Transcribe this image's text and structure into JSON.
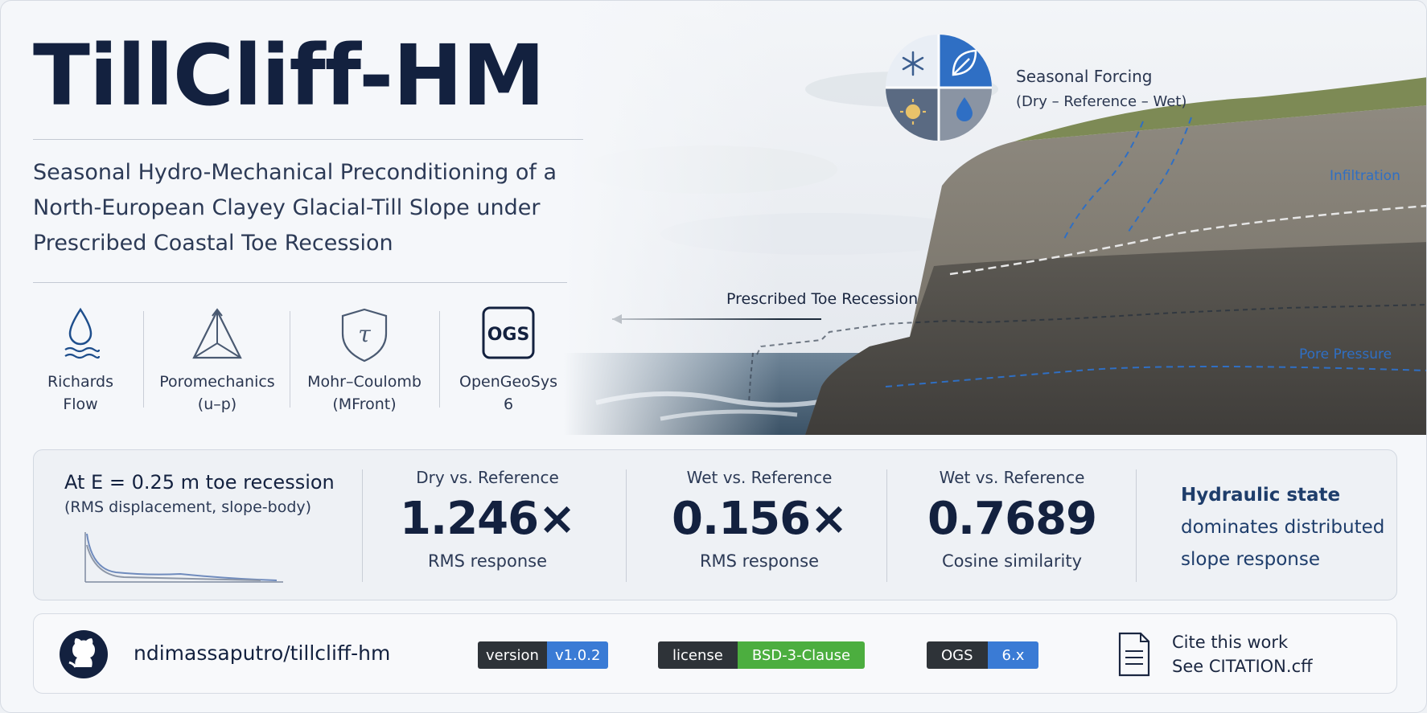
{
  "title": "TillCliff-HM",
  "subtitle": "Seasonal Hydro-Mechanical Preconditioning of a North-European Clayey Glacial-Till Slope under Prescribed Coastal Toe Recession",
  "features": [
    {
      "line1": "Richards",
      "line2": "Flow",
      "icon": "water-drop-icon"
    },
    {
      "line1": "Poromechanics",
      "line2": "(u–p)",
      "icon": "triangle-truss-icon"
    },
    {
      "line1": "Mohr–Coulomb",
      "line2": "(MFront)",
      "icon": "tau-shield-icon"
    },
    {
      "line1": "OpenGeoSys",
      "line2": "6",
      "icon": "ogs-logo-icon",
      "icon_text": "OGS"
    }
  ],
  "seasonal": {
    "title": "Seasonal Forcing",
    "subtitle": "(Dry – Reference – Wet)",
    "quadrants": [
      "snowflake-icon",
      "leaf-icon",
      "sun-icon",
      "water-drop-icon"
    ]
  },
  "annotations": {
    "toe": "Prescribed Toe Recession",
    "infiltration": "Infiltration",
    "pore": "Pore Pressure"
  },
  "stats": {
    "heading": "At E = 0.25 m toe recession",
    "subheading": "(RMS displacement, slope-body)",
    "metrics": [
      {
        "top": "Dry vs. Reference",
        "value": "1.246×",
        "bottom": "RMS response"
      },
      {
        "top": "Wet vs. Reference",
        "value": "0.156×",
        "bottom": "RMS response"
      },
      {
        "top": "Wet vs. Reference",
        "value": "0.7689",
        "bottom": "Cosine similarity"
      }
    ],
    "takeaway": {
      "line1": "Hydraulic state",
      "line2": "dominates distributed",
      "line3": "slope response"
    }
  },
  "footer": {
    "repo": "ndimassaputro/tillcliff-hm",
    "badges": [
      {
        "key": "version",
        "value": "v1.0.2",
        "color": "#3a7bd5"
      },
      {
        "key": "license",
        "value": "BSD-3-Clause",
        "color": "#4cae3f"
      },
      {
        "key": "OGS",
        "value": "6.x",
        "color": "#3a7bd5"
      }
    ],
    "cite_line1": "Cite this work",
    "cite_line2": "See CITATION.cff"
  },
  "colors": {
    "accent": "#2f6fc4",
    "dark": "#13213f"
  }
}
